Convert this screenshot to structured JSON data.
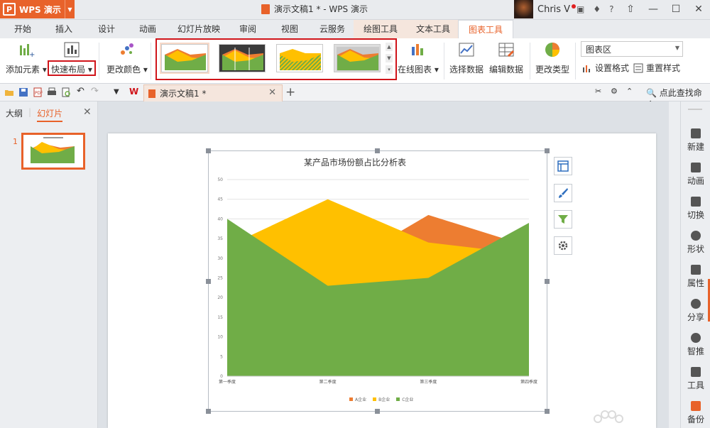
{
  "app": {
    "name": "WPS 演示",
    "logo_letter": "P"
  },
  "window": {
    "title": "演示文稿1 * - WPS 演示",
    "user": "Chris V"
  },
  "menu": {
    "tabs": [
      "开始",
      "插入",
      "设计",
      "动画",
      "幻灯片放映",
      "审阅",
      "视图",
      "云服务",
      "绘图工具",
      "文本工具",
      "图表工具"
    ],
    "active": "图表工具"
  },
  "ribbon": {
    "add_element": "添加元素",
    "quick_layout": "快速布局",
    "change_color": "更改颜色",
    "online_chart": "在线图表",
    "select_data": "选择数据",
    "edit_data": "编辑数据",
    "change_type": "更改类型",
    "chart_area_select": "图表区",
    "format_btn": "设置格式",
    "reset_style": "重置样式"
  },
  "doc_tab": {
    "label": "演示文稿1 *"
  },
  "find_command": "点此查找命令",
  "left_panel": {
    "tab_outline": "大纲",
    "tab_slides": "幻灯片",
    "slide_number": "1"
  },
  "right_panel": {
    "items": [
      "新建",
      "动画",
      "切换",
      "形状",
      "属性",
      "分享",
      "智推",
      "工具",
      "备份"
    ]
  },
  "colors": {
    "accent": "#e8622a",
    "series_a": "#ed7d31",
    "series_b": "#ffc000",
    "series_c": "#70ad47"
  },
  "chart_data": {
    "type": "area",
    "title": "某产品市场份额占比分析表",
    "categories": [
      "第一季度",
      "第二季度",
      "第三季度",
      "第四季度"
    ],
    "series": [
      {
        "name": "A企业",
        "values": [
          20,
          26,
          41,
          33
        ]
      },
      {
        "name": "B企业",
        "values": [
          33,
          45,
          34,
          31
        ]
      },
      {
        "name": "C企业",
        "values": [
          40,
          23,
          25,
          39
        ]
      }
    ],
    "ylim": [
      0,
      50
    ],
    "yticks": [
      "0",
      "5",
      "10",
      "15",
      "20",
      "25",
      "30",
      "35",
      "40",
      "45",
      "50"
    ],
    "grid": true,
    "legend": "bottom"
  }
}
